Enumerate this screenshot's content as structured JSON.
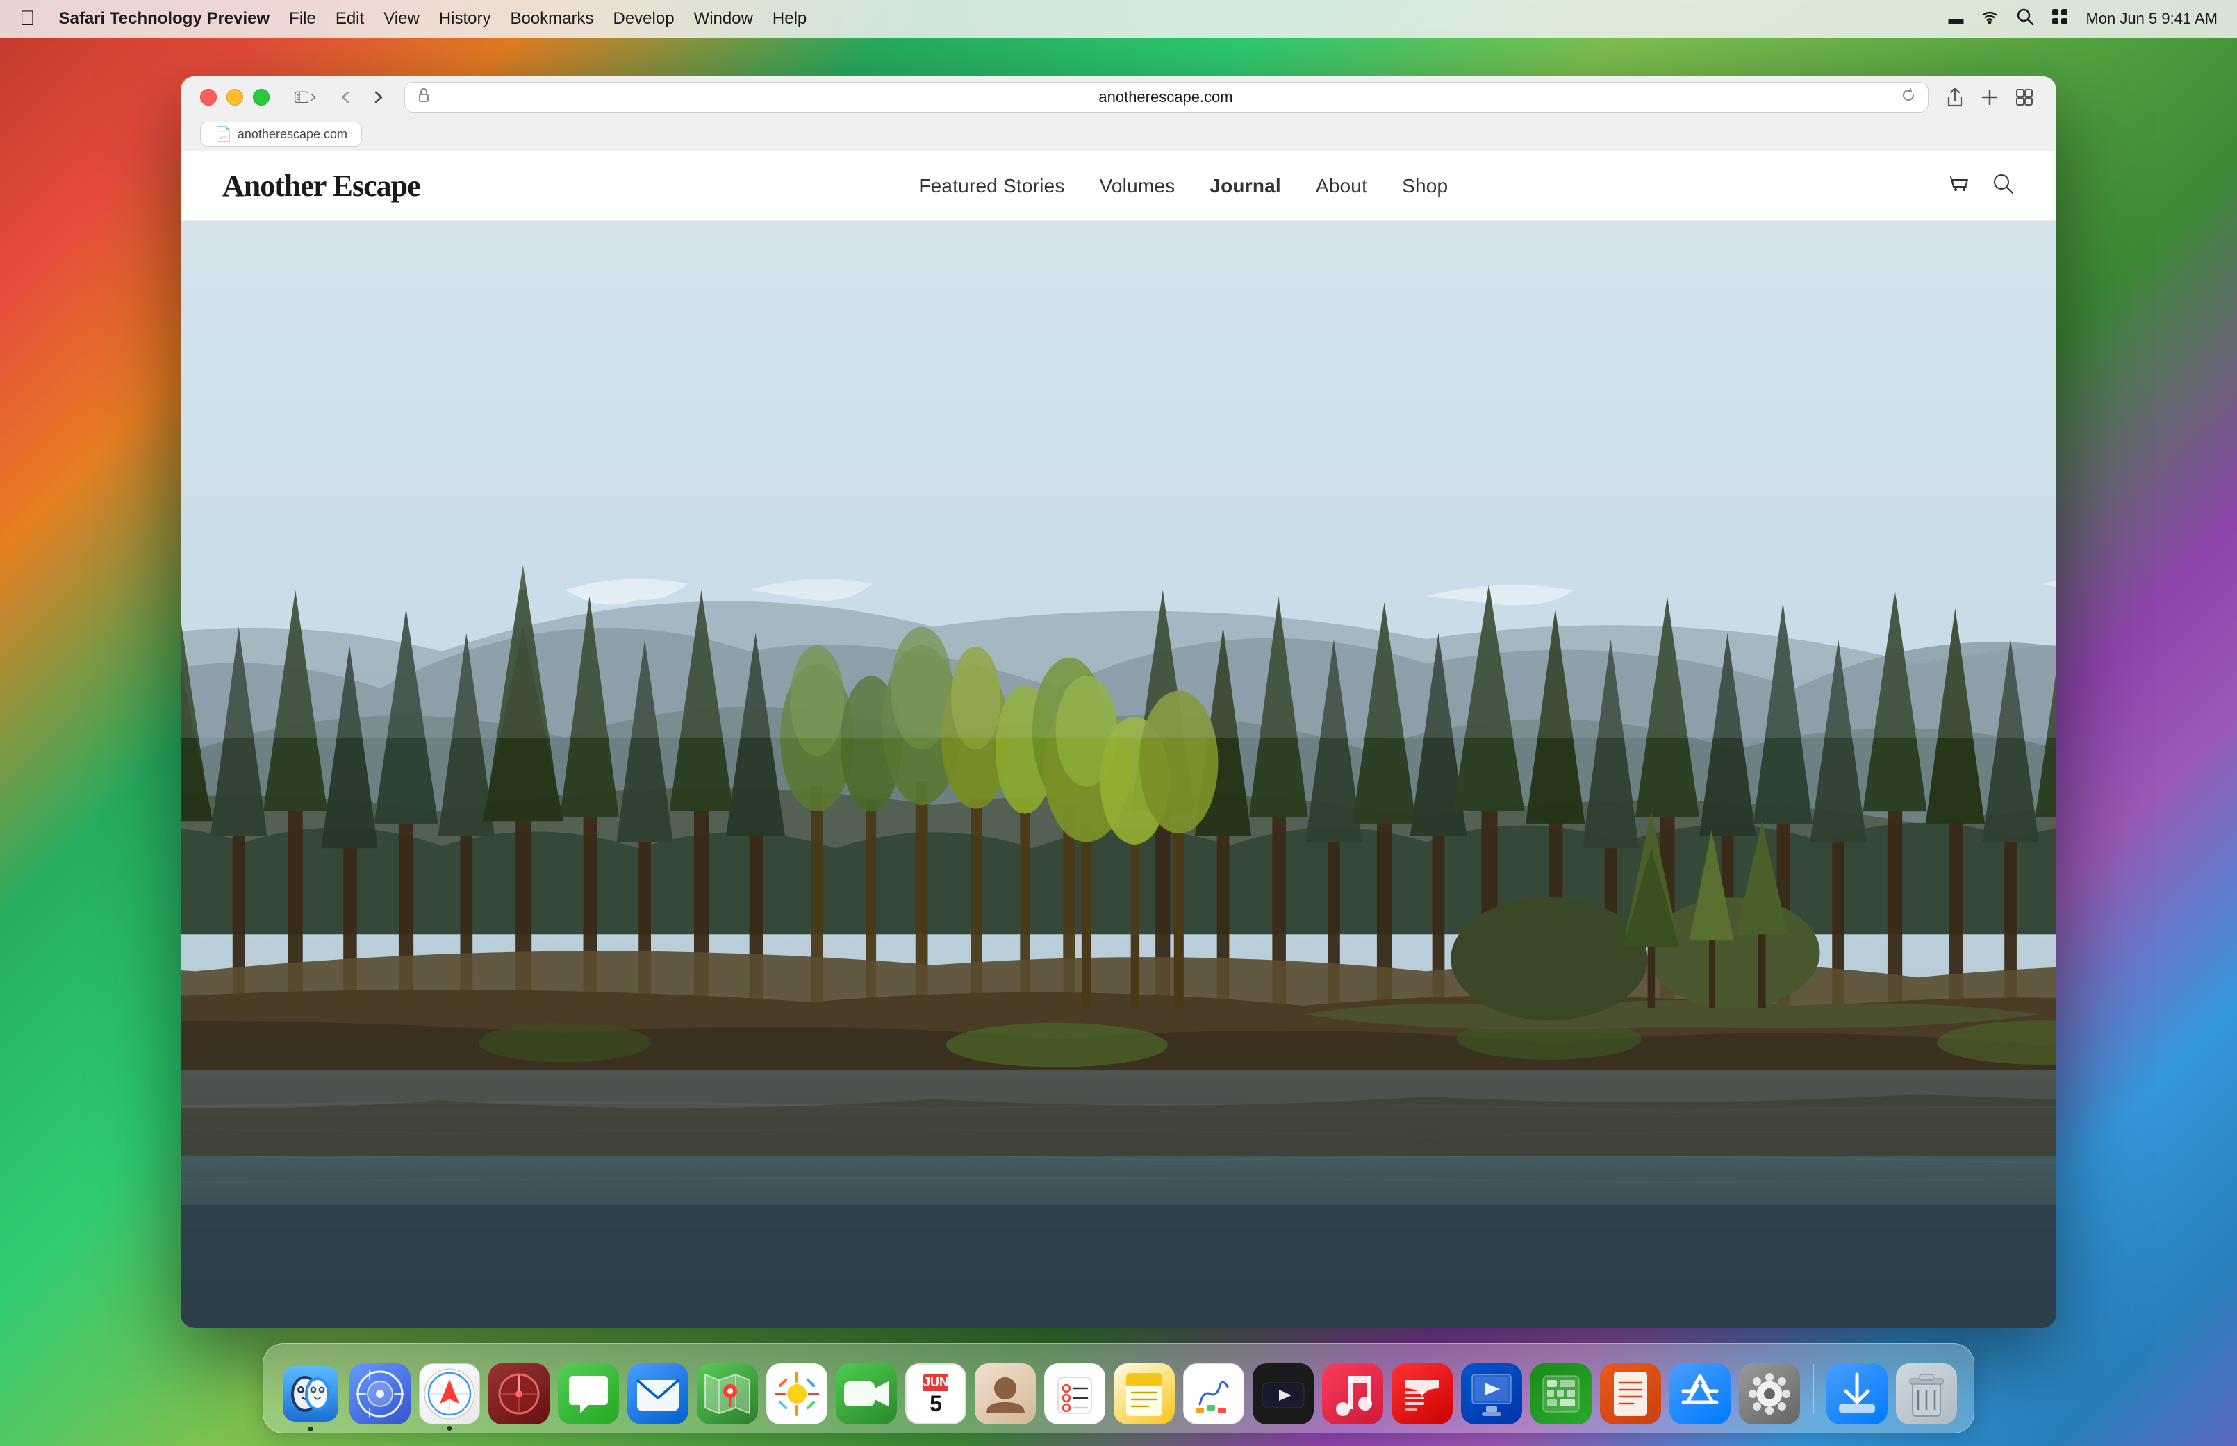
{
  "desktop": {
    "bg_description": "macOS Sonoma colorful gradient wallpaper"
  },
  "menubar": {
    "apple_symbol": "",
    "app_name": "Safari Technology Preview",
    "items": [
      "File",
      "Edit",
      "View",
      "History",
      "Bookmarks",
      "Develop",
      "Window",
      "Help"
    ],
    "right": {
      "battery": "🔋",
      "wifi": "WiFi",
      "search": "🔍",
      "control_center": "⊞",
      "datetime": "Mon Jun 5  9:41 AM"
    }
  },
  "browser": {
    "url": "anotherescape.com",
    "tab_icon": "📄",
    "actions": {
      "share": "⬆",
      "new_tab": "+",
      "tab_overview": "⧉"
    }
  },
  "website": {
    "logo": "Another Escape",
    "nav": {
      "links": [
        {
          "label": "Featured Stories",
          "active": false
        },
        {
          "label": "Volumes",
          "active": false
        },
        {
          "label": "Journal",
          "active": true
        },
        {
          "label": "About",
          "active": false
        },
        {
          "label": "Shop",
          "active": false
        }
      ]
    },
    "hero": {
      "description": "Scottish highland landscape with loch, pine trees and mountains"
    }
  },
  "dock": {
    "apps": [
      {
        "name": "Finder",
        "icon": "😊",
        "class": "dock-finder",
        "has_dot": true
      },
      {
        "name": "Launchpad",
        "icon": "🚀",
        "class": "dock-launchpad",
        "has_dot": false
      },
      {
        "name": "Safari",
        "icon": "🧭",
        "class": "dock-safari",
        "has_dot": true
      },
      {
        "name": "Instruments",
        "icon": "🎸",
        "class": "dock-instruments",
        "has_dot": false
      },
      {
        "name": "Messages",
        "icon": "💬",
        "class": "dock-messages",
        "has_dot": true
      },
      {
        "name": "Mail",
        "icon": "✉️",
        "class": "dock-mail",
        "has_dot": false
      },
      {
        "name": "Maps",
        "icon": "🗺️",
        "class": "dock-maps",
        "has_dot": false
      },
      {
        "name": "Photos",
        "icon": "🌸",
        "class": "dock-photos",
        "has_dot": false
      },
      {
        "name": "FaceTime",
        "icon": "📹",
        "class": "dock-facetime",
        "has_dot": false
      },
      {
        "name": "Calendar",
        "icon": "cal",
        "class": "dock-calendar",
        "has_dot": false
      },
      {
        "name": "Contacts",
        "icon": "👤",
        "class": "dock-contacts",
        "has_dot": false
      },
      {
        "name": "Reminders",
        "icon": "☑️",
        "class": "dock-reminders",
        "has_dot": false
      },
      {
        "name": "Notes",
        "icon": "📝",
        "class": "dock-notes",
        "has_dot": false
      },
      {
        "name": "Freeform",
        "icon": "✏️",
        "class": "dock-freeform",
        "has_dot": false
      },
      {
        "name": "Apple TV",
        "icon": "📺",
        "class": "dock-appletv",
        "has_dot": false
      },
      {
        "name": "Music",
        "icon": "🎵",
        "class": "dock-music",
        "has_dot": false
      },
      {
        "name": "News",
        "icon": "📰",
        "class": "dock-news",
        "has_dot": false
      },
      {
        "name": "Keynote",
        "icon": "📊",
        "class": "dock-keynote",
        "has_dot": false
      },
      {
        "name": "Numbers",
        "icon": "📈",
        "class": "dock-numbers",
        "has_dot": false
      },
      {
        "name": "Pages",
        "icon": "📄",
        "class": "dock-pages",
        "has_dot": false
      },
      {
        "name": "App Store",
        "icon": "🅐",
        "class": "dock-appstore",
        "has_dot": false
      },
      {
        "name": "System Preferences",
        "icon": "⚙️",
        "class": "dock-systemprefs",
        "has_dot": false
      },
      {
        "name": "Download",
        "icon": "⬇️",
        "class": "dock-download",
        "has_dot": false
      },
      {
        "name": "Trash",
        "icon": "🗑️",
        "class": "dock-trash",
        "has_dot": false
      }
    ],
    "calendar_month": "JUN",
    "calendar_day": "5"
  }
}
